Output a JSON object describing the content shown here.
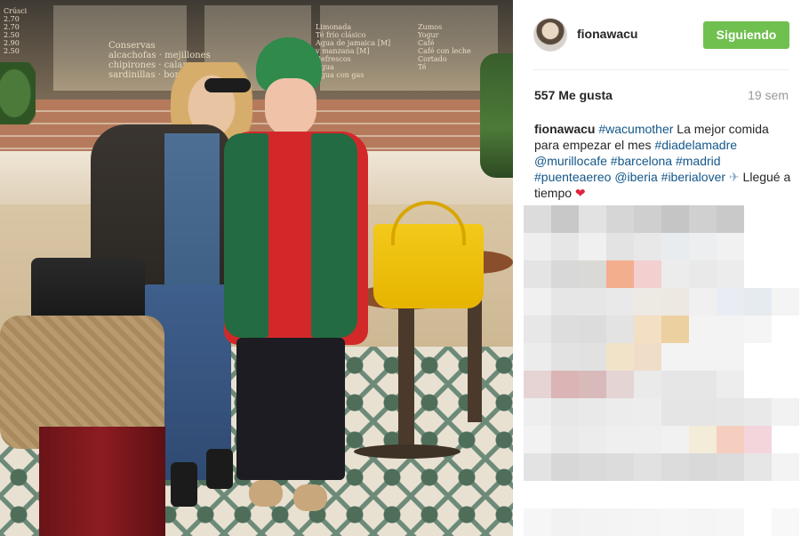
{
  "post": {
    "image_alt": "Two women posing in a cafe",
    "cafe_menu_left": [
      "Crúsci",
      "2.70",
      "2.70",
      "2.50",
      "2.90",
      "2.50"
    ],
    "cafe_menu_center": [
      "Conservas",
      "alcachofas · mejillones",
      "chipirones · calamares",
      "sardinillas · bonito"
    ],
    "cafe_menu_right": [
      "Limonada",
      "Té frío clásico",
      "Agua de jamaica [M]",
      "y manzana [M]",
      "Refrescos",
      "Agua",
      "Agua con gas"
    ],
    "cafe_menu_far_right": [
      "Zumos",
      "Yogur",
      "Café",
      "Café con leche",
      "Cortado",
      "Té"
    ]
  },
  "header": {
    "username": "fionawacu",
    "follow_label": "Siguiendo",
    "follow_color": "#70c050"
  },
  "stats": {
    "likes": "557 Me gusta",
    "time_ago": "19 sem"
  },
  "caption": {
    "user": "fionawacu",
    "segments": [
      {
        "type": "tag",
        "text": "#wacumother"
      },
      {
        "type": "text",
        "text": " La mejor comida para empezar el mes "
      },
      {
        "type": "tag",
        "text": "#diadelamadre"
      },
      {
        "type": "text",
        "text": " "
      },
      {
        "type": "tag",
        "text": "@murillocafe"
      },
      {
        "type": "text",
        "text": " "
      },
      {
        "type": "tag",
        "text": "#barcelona"
      },
      {
        "type": "text",
        "text": " "
      },
      {
        "type": "tag",
        "text": "#madrid"
      },
      {
        "type": "text",
        "text": " "
      },
      {
        "type": "tag",
        "text": "#puenteaereo"
      },
      {
        "type": "text",
        "text": " "
      },
      {
        "type": "tag",
        "text": "@iberia"
      },
      {
        "type": "text",
        "text": " "
      },
      {
        "type": "tag",
        "text": "#iberialover"
      },
      {
        "type": "text",
        "text": " "
      },
      {
        "type": "icon",
        "name": "airplane-icon",
        "text": "✈"
      },
      {
        "type": "text",
        "text": " Llegué a tiempo "
      },
      {
        "type": "icon",
        "name": "heart-icon",
        "text": "❤"
      }
    ]
  },
  "colors": {
    "tag": "#125688",
    "muted": "#999999",
    "text": "#262626"
  },
  "pixelated_comments": [
    [
      "#dcdcdc",
      "#c8c8c8",
      "#e2e2e2",
      "#d6d6d6",
      "#cfcfcf",
      "#c5c5c5",
      "#d0d0d0",
      "#c9c9c9",
      "#ffffff",
      "#ffffff"
    ],
    [
      "#eeeeee",
      "#e6e6e6",
      "#f0f0f0",
      "#e3e3e3",
      "#e8e8e8",
      "#e9ecef",
      "#edeef0",
      "#f1f1f1",
      "#ffffff",
      "#ffffff"
    ],
    [
      "#e4e4e4",
      "#d8d8d8",
      "#d9d9d5",
      "#f3ae8e",
      "#f3cfd0",
      "#ececec",
      "#e9e9e9",
      "#ececec",
      "#ffffff",
      "#ffffff"
    ],
    [
      "#f0f0f0",
      "#e6e6e6",
      "#e6e6e6",
      "#e9e9e9",
      "#ede9e3",
      "#ede9e1",
      "#f0f0f0",
      "#e9edf3",
      "#e6ebf0",
      "#f4f4f4"
    ],
    [
      "#e7e7e7",
      "#dddddd",
      "#dcdcdc",
      "#e3e3e3",
      "#f3dfc3",
      "#ecd09f",
      "#f3f3f3",
      "#f3f3f3",
      "#f5f5f5",
      "#ffffff"
    ],
    [
      "#ececec",
      "#e2e2e2",
      "#e1e1e1",
      "#f1e3c8",
      "#f0ddc9",
      "#f3f3f3",
      "#f3f3f3",
      "#f3f3f3",
      "#ffffff",
      "#ffffff"
    ],
    [
      "#e6d3d3",
      "#dbb5b5",
      "#d9baba",
      "#e5d4d4",
      "#eaeaea",
      "#e6e6e6",
      "#e6e6e6",
      "#ededed",
      "#ffffff",
      "#ffffff"
    ],
    [
      "#eeeeee",
      "#e7e7e7",
      "#e9e9e9",
      "#ececec",
      "#ededed",
      "#e5e5e5",
      "#e5e5e5",
      "#e6e6e6",
      "#e9e9e9",
      "#f2f2f2"
    ],
    [
      "#f2f2f2",
      "#e9e9e9",
      "#ececec",
      "#efefef",
      "#efefef",
      "#f1f1f1",
      "#f2ecd9",
      "#f6cec0",
      "#f4d5dc",
      "#ffffff"
    ],
    [
      "#e3e3e3",
      "#d7d7d7",
      "#dadada",
      "#dcdcdc",
      "#e1e1e1",
      "#dcdcdc",
      "#d9d9d9",
      "#dcdcdc",
      "#e6e6e6",
      "#f3f3f3"
    ],
    [
      "#ffffff",
      "#ffffff",
      "#ffffff",
      "#ffffff",
      "#ffffff",
      "#ffffff",
      "#ffffff",
      "#ffffff",
      "#ffffff",
      "#ffffff"
    ],
    [
      "#f6f6f6",
      "#f2f2f2",
      "#f3f3f3",
      "#f4f4f4",
      "#f5f5f5",
      "#f6f6f6",
      "#f5f5f5",
      "#f6f6f6",
      "#ffffff",
      "#f8f8f8"
    ]
  ]
}
